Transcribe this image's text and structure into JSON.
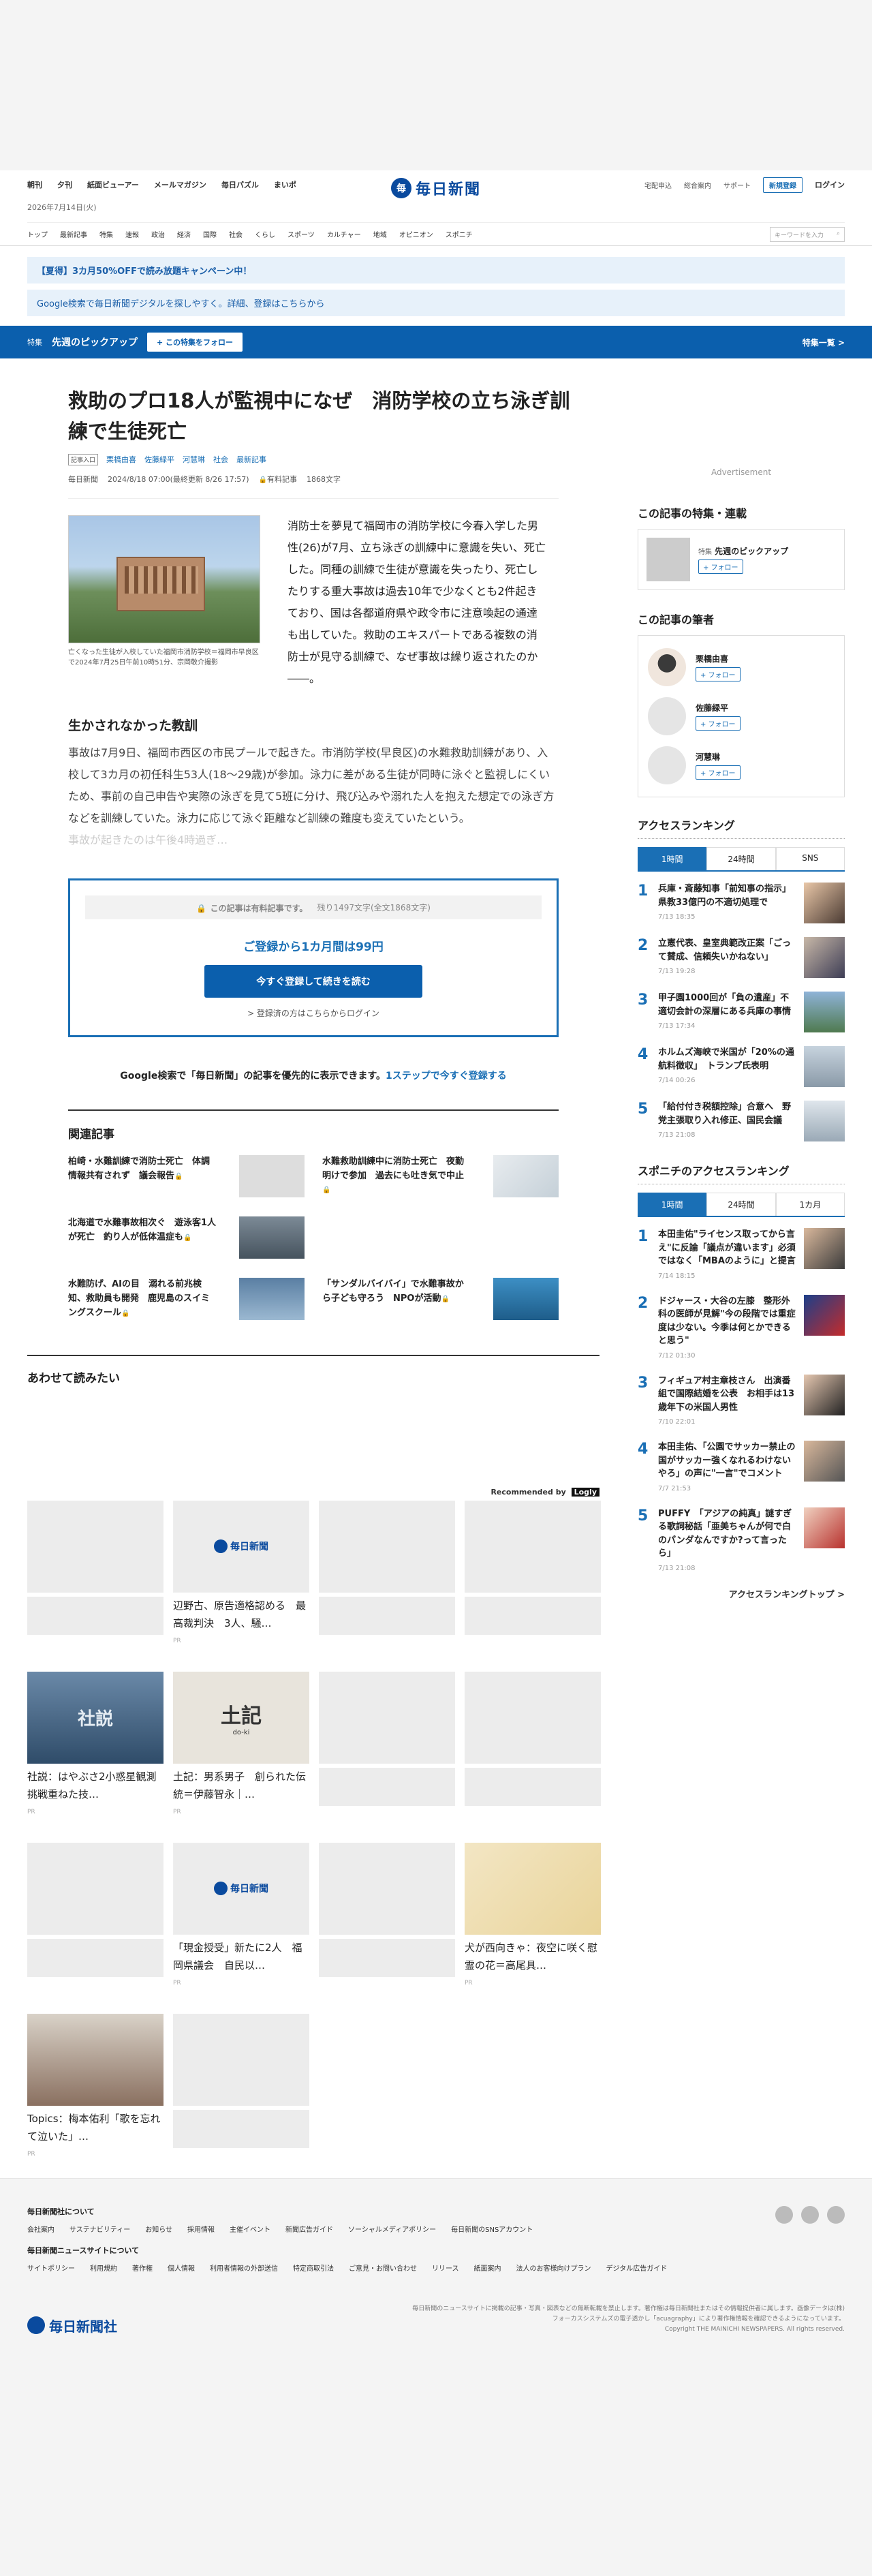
{
  "header": {
    "nav_left": [
      "朝刊",
      "夕刊",
      "紙面ビューアー",
      "メールマガジン",
      "毎日パズル",
      "まいポ"
    ],
    "brand": "毎日新聞",
    "nav_right": [
      "宅配申込",
      "総合案内",
      "サポート"
    ],
    "register": "新規登録",
    "login": "ログイン",
    "date": "2026年7月14日(火)",
    "categories": [
      "トップ",
      "最新記事",
      "特集",
      "速報",
      "政治",
      "経済",
      "国際",
      "社会",
      "くらし",
      "スポーツ",
      "カルチャー",
      "地域",
      "オピニオン",
      "スポニチ"
    ],
    "search_placeholder": "キーワードを入力"
  },
  "banners": {
    "campaign": "【夏得】3カ月50%OFFで読み放題キャンペーン中！",
    "google": "Google検索で毎日新聞デジタルを探しやすく。詳細、登録はこちらから"
  },
  "tokushu": {
    "label": "特集",
    "title": "先週のピックアップ",
    "follow": "+ この特集をフォロー",
    "more": "特集一覧 >"
  },
  "article": {
    "title": "救助のプロ18人が監視中になぜ　消防学校の立ち泳ぎ訓練で生徒死亡",
    "tag": "記事入口",
    "authors": [
      "栗橋由喜",
      "佐藤緑平",
      "河慧琳"
    ],
    "section": "社会",
    "latest": "最新記事",
    "source": "毎日新聞",
    "dates": "2024/8/18 07:00(最終更新 8/26 17:57)",
    "paid": "有料記事",
    "chars": "1868文字",
    "caption": "亡くなった生徒が入校していた福岡市消防学校＝福岡市早良区で2024年7月25日午前10時51分、宗岡敬介撮影",
    "lead": "消防士を夢見て福岡市の消防学校に今春入学した男性(26)が7月、立ち泳ぎの訓練中に意識を失い、死亡した。同種の訓練で生徒が意識を失ったり、死亡したりする重大事故は過去10年で少なくとも2件起きており、国は各都道府県や政令市に注意喚起の通達も出していた。救助のエキスパートである複数の消防士が見守る訓練で、なぜ事故は繰り返されたのか――。",
    "subhead": "生かされなかった教訓",
    "body": "事故は7月9日、福岡市西区の市民プールで起きた。市消防学校(早良区)の水難救助訓練があり、入校して3カ月の初任科生53人(18〜29歳)が参加。泳力に差がある生徒が同時に泳ぐと監視しにくいため、事前の自己申告や実際の泳ぎを見て5班に分け、飛び込みや溺れた人を抱えた想定での泳ぎ方などを訓練していた。泳力に応じて泳ぐ距離など訓練の難度も変えていたという。",
    "fade": "事故が起きたのは午後4時過ぎ…"
  },
  "paywall": {
    "head": "この記事は有料記事です。",
    "remain": "残り1497文字(全文1868文字)",
    "offer": "ご登録から1カ月間は99円",
    "button": "今すぐ登録して続きを読む",
    "login": "> 登録済の方はこちらからログイン"
  },
  "gnote": {
    "text": "Google検索で「毎日新聞」の記事を優先的に表示できます。",
    "link": "1ステップで今すぐ登録する"
  },
  "related": {
    "heading": "関連記事",
    "items": [
      "柏崎・水難訓練で消防士死亡　体調情報共有されず　議会報告",
      "水難救助訓練中に消防士死亡　夜勤明けで参加　過去にも吐き気で中止",
      "北海道で水難事故相次ぐ　遊泳客1人が死亡　釣り人が低体温症も",
      "水難防げ、AIの目　溺れる前兆検知、救助員も開発　鹿児島のスイミングスクール",
      "「サンダルバイバイ」で水難事故から子ども守ろう　NPOが活動"
    ]
  },
  "awase": {
    "heading": "あわせて読みたい",
    "recby": "Recommended by",
    "logo": "Logly",
    "pr": "PR",
    "cards": [
      "辺野古、原告適格認める　最高裁判決　3人、騒…",
      "社説：はやぶさ2小惑星観測　挑戦重ねた技…",
      "土記：男系男子　創られた伝統＝伊藤智永｜…",
      "「現金授受」新たに2人　福岡県議会　自民以…",
      "犬が西向きゃ：夜空に咲く慰霊の花＝高尾具…",
      "Topics：梅本佑利「歌を忘れて泣いた」…"
    ],
    "logotext": "毎日新聞",
    "shasetsu": "社説",
    "doki": "土記",
    "doki_sub": "do-ki"
  },
  "sidebar": {
    "ads": "Advertisement",
    "feature_heading": "この記事の特集・連載",
    "feature_label": "特集",
    "feature_title": "先週のピックアップ",
    "follow": "+ フォロー",
    "authors_heading": "この記事の筆者",
    "authors": [
      "栗橋由喜",
      "佐藤緑平",
      "河慧琳"
    ],
    "ranking_heading": "アクセスランキング",
    "ranking_tabs": [
      "1時間",
      "24時間",
      "SNS"
    ],
    "ranking": [
      {
        "t": "兵庫・斎藤知事「前知事の指示」県教33億円の不適切処理で",
        "d": "7/13 18:35"
      },
      {
        "t": "立憲代表、皇室典範改正案「ごって賛成、信頼失いかねない」",
        "d": "7/13 19:28"
      },
      {
        "t": "甲子園1000回が「負の遺産」不適切会計の深層にある兵庫の事情",
        "d": "7/13 17:34"
      },
      {
        "t": "ホルムズ海峡で米国が「20%の通航料徴収」　トランプ氏表明",
        "d": "7/14 00:26"
      },
      {
        "t": "「給付付き税額控除」合意へ　野党主張取り入れ修正、国民会議",
        "d": "7/13 21:08"
      }
    ],
    "sponichi_heading": "スポニチのアクセスランキング",
    "sponichi_tabs": [
      "1時間",
      "24時間",
      "1カ月"
    ],
    "sponichi": [
      {
        "t": "本田圭佑\"ライセンス取ってから言え\"に反論「議点が違います」必須ではなく「MBAのように」と提言",
        "d": "7/14 18:15"
      },
      {
        "t": "ドジャース・大谷の左膝　整形外科の医師が見解\"今の段階では重症度は少ない。今季は何とかできると思う\"",
        "d": "7/12 01:30"
      },
      {
        "t": "フィギュア村主章枝さん　出演番組で国際結婚を公表　お相手は13歳年下の米国人男性",
        "d": "7/10 22:01"
      },
      {
        "t": "本田圭佑、「公園でサッカー禁止の国がサッカー強くなれるわけないやろ」の声に\"一言\"でコメント",
        "d": "7/7 21:53"
      },
      {
        "t": "PUFFY　「アジアの純真」謎すぎる歌詞秘話「亜美ちゃんが何で白のパンダなんですか?って言ったら」",
        "d": "7/13 21:08"
      }
    ],
    "ranking_more": "アクセスランキングトップ >"
  },
  "footer": {
    "about": "毎日新聞社について",
    "links1": [
      "会社案内",
      "サステナビリティー",
      "お知らせ",
      "採用情報",
      "主催イベント",
      "新聞広告ガイド",
      "ソーシャルメディアポリシー",
      "毎日新聞のSNSアカウント"
    ],
    "site": "毎日新聞ニュースサイトについて",
    "links2": [
      "サイトポリシー",
      "利用規約",
      "著作権",
      "個人情報",
      "利用者情報の外部送信",
      "特定商取引法",
      "ご意見・お問い合わせ",
      "リリース",
      "紙面案内",
      "法人のお客様向けプラン",
      "デジタル広告ガイド"
    ],
    "logo": "毎日新聞社",
    "notice": "毎日新聞のニュースサイトに掲載の記事・写真・図表などの無断転載を禁止します。著作権は毎日新聞社またはその情報提供者に属します。画像データは(株)フォーカスシステムズの電子透かし「acuagraphy」により著作権情報を確認できるようになっています。",
    "copy": "Copyright THE MAINICHI NEWSPAPERS. All rights reserved."
  }
}
